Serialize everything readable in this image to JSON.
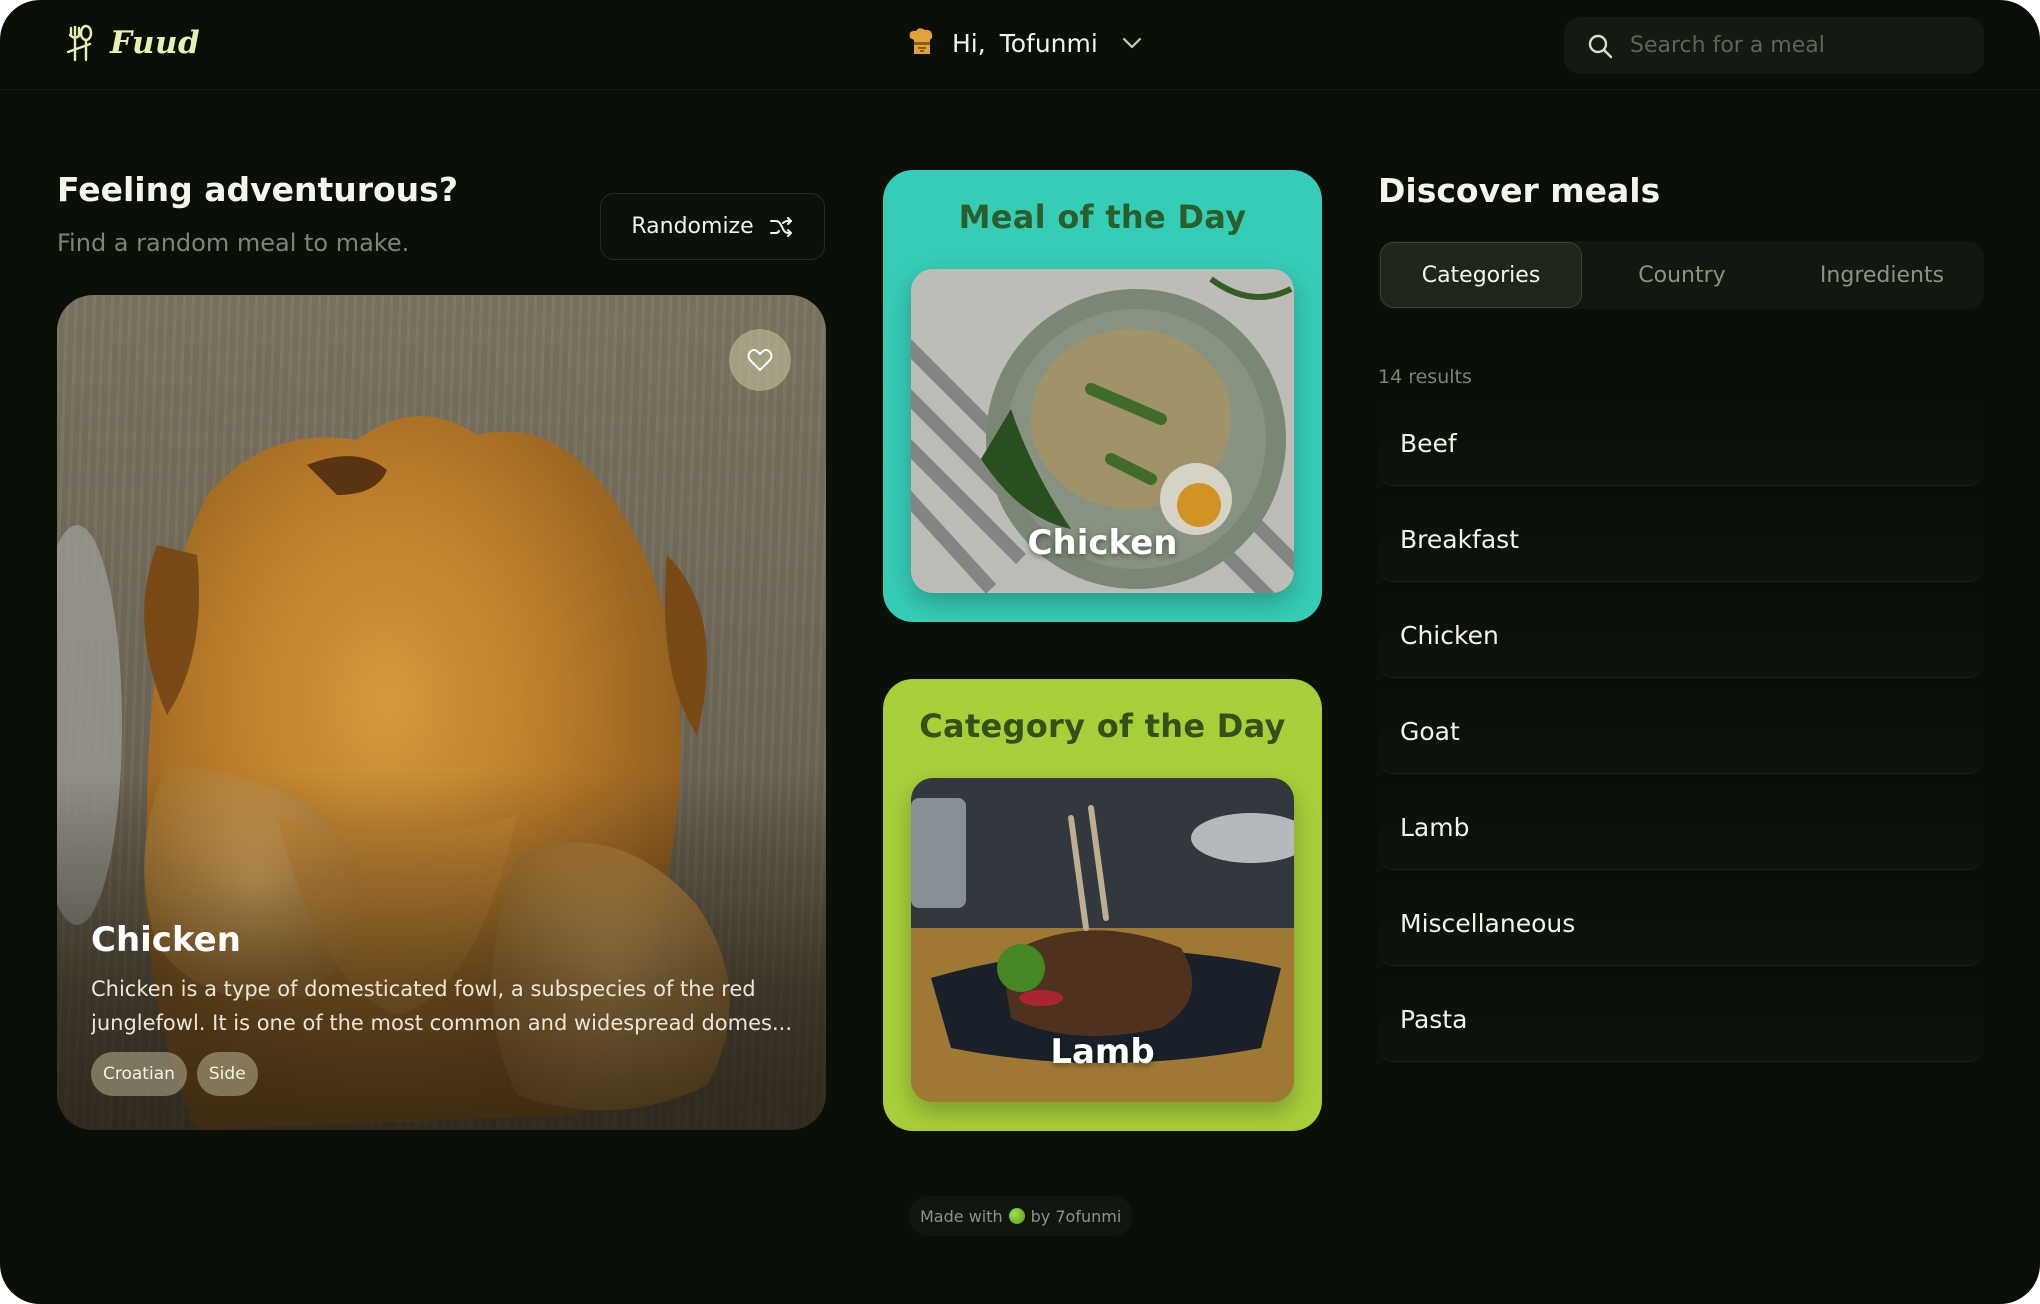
{
  "header": {
    "brand": "Fuud",
    "greeting_prefix": "Hi,",
    "user_name": "Tofunmi",
    "search_placeholder": "Search for a meal"
  },
  "adventure": {
    "title": "Feeling adventurous?",
    "subtitle": "Find a random meal to make.",
    "randomize_label": "Randomize",
    "card": {
      "title": "Chicken",
      "desc_line1": "Chicken is a type of domesticated fowl, a subspecies of the red",
      "desc_line2": "junglefowl. It is one of the most common and widespread domes...",
      "tags": [
        "Croatian",
        "Side"
      ]
    }
  },
  "meal_of_day": {
    "heading": "Meal of the Day",
    "label": "Chicken"
  },
  "category_of_day": {
    "heading": "Category of the Day",
    "label": "Lamb"
  },
  "discover": {
    "title": "Discover meals",
    "tabs": [
      "Categories",
      "Country",
      "Ingredients"
    ],
    "active_tab": "Categories",
    "results": "14 results",
    "categories": [
      "Beef",
      "Breakfast",
      "Chicken",
      "Goat",
      "Lamb",
      "Miscellaneous",
      "Pasta"
    ]
  },
  "footer": {
    "made_with": "Made with",
    "by": "by 7ofunmi"
  },
  "colors": {
    "background": "#0a0f07",
    "meal_card": "#36cdb6",
    "category_card": "#a8cf3a",
    "brand_text": "#e7f0b2"
  }
}
